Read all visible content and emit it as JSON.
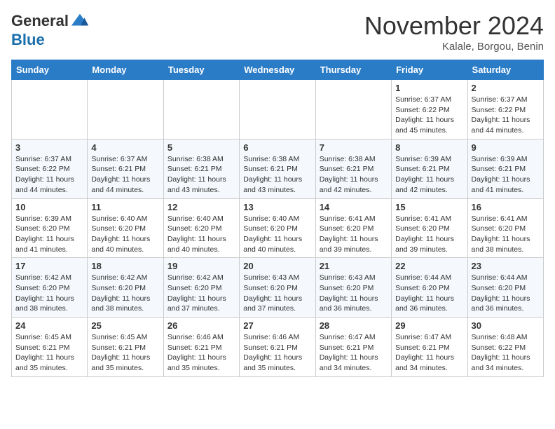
{
  "header": {
    "logo_general": "General",
    "logo_blue": "Blue",
    "month_title": "November 2024",
    "location": "Kalale, Borgou, Benin"
  },
  "days_of_week": [
    "Sunday",
    "Monday",
    "Tuesday",
    "Wednesday",
    "Thursday",
    "Friday",
    "Saturday"
  ],
  "weeks": [
    [
      {
        "day": "",
        "detail": ""
      },
      {
        "day": "",
        "detail": ""
      },
      {
        "day": "",
        "detail": ""
      },
      {
        "day": "",
        "detail": ""
      },
      {
        "day": "",
        "detail": ""
      },
      {
        "day": "1",
        "detail": "Sunrise: 6:37 AM\nSunset: 6:22 PM\nDaylight: 11 hours and 45 minutes."
      },
      {
        "day": "2",
        "detail": "Sunrise: 6:37 AM\nSunset: 6:22 PM\nDaylight: 11 hours and 44 minutes."
      }
    ],
    [
      {
        "day": "3",
        "detail": "Sunrise: 6:37 AM\nSunset: 6:22 PM\nDaylight: 11 hours and 44 minutes."
      },
      {
        "day": "4",
        "detail": "Sunrise: 6:37 AM\nSunset: 6:21 PM\nDaylight: 11 hours and 44 minutes."
      },
      {
        "day": "5",
        "detail": "Sunrise: 6:38 AM\nSunset: 6:21 PM\nDaylight: 11 hours and 43 minutes."
      },
      {
        "day": "6",
        "detail": "Sunrise: 6:38 AM\nSunset: 6:21 PM\nDaylight: 11 hours and 43 minutes."
      },
      {
        "day": "7",
        "detail": "Sunrise: 6:38 AM\nSunset: 6:21 PM\nDaylight: 11 hours and 42 minutes."
      },
      {
        "day": "8",
        "detail": "Sunrise: 6:39 AM\nSunset: 6:21 PM\nDaylight: 11 hours and 42 minutes."
      },
      {
        "day": "9",
        "detail": "Sunrise: 6:39 AM\nSunset: 6:21 PM\nDaylight: 11 hours and 41 minutes."
      }
    ],
    [
      {
        "day": "10",
        "detail": "Sunrise: 6:39 AM\nSunset: 6:20 PM\nDaylight: 11 hours and 41 minutes."
      },
      {
        "day": "11",
        "detail": "Sunrise: 6:40 AM\nSunset: 6:20 PM\nDaylight: 11 hours and 40 minutes."
      },
      {
        "day": "12",
        "detail": "Sunrise: 6:40 AM\nSunset: 6:20 PM\nDaylight: 11 hours and 40 minutes."
      },
      {
        "day": "13",
        "detail": "Sunrise: 6:40 AM\nSunset: 6:20 PM\nDaylight: 11 hours and 40 minutes."
      },
      {
        "day": "14",
        "detail": "Sunrise: 6:41 AM\nSunset: 6:20 PM\nDaylight: 11 hours and 39 minutes."
      },
      {
        "day": "15",
        "detail": "Sunrise: 6:41 AM\nSunset: 6:20 PM\nDaylight: 11 hours and 39 minutes."
      },
      {
        "day": "16",
        "detail": "Sunrise: 6:41 AM\nSunset: 6:20 PM\nDaylight: 11 hours and 38 minutes."
      }
    ],
    [
      {
        "day": "17",
        "detail": "Sunrise: 6:42 AM\nSunset: 6:20 PM\nDaylight: 11 hours and 38 minutes."
      },
      {
        "day": "18",
        "detail": "Sunrise: 6:42 AM\nSunset: 6:20 PM\nDaylight: 11 hours and 38 minutes."
      },
      {
        "day": "19",
        "detail": "Sunrise: 6:42 AM\nSunset: 6:20 PM\nDaylight: 11 hours and 37 minutes."
      },
      {
        "day": "20",
        "detail": "Sunrise: 6:43 AM\nSunset: 6:20 PM\nDaylight: 11 hours and 37 minutes."
      },
      {
        "day": "21",
        "detail": "Sunrise: 6:43 AM\nSunset: 6:20 PM\nDaylight: 11 hours and 36 minutes."
      },
      {
        "day": "22",
        "detail": "Sunrise: 6:44 AM\nSunset: 6:20 PM\nDaylight: 11 hours and 36 minutes."
      },
      {
        "day": "23",
        "detail": "Sunrise: 6:44 AM\nSunset: 6:20 PM\nDaylight: 11 hours and 36 minutes."
      }
    ],
    [
      {
        "day": "24",
        "detail": "Sunrise: 6:45 AM\nSunset: 6:21 PM\nDaylight: 11 hours and 35 minutes."
      },
      {
        "day": "25",
        "detail": "Sunrise: 6:45 AM\nSunset: 6:21 PM\nDaylight: 11 hours and 35 minutes."
      },
      {
        "day": "26",
        "detail": "Sunrise: 6:46 AM\nSunset: 6:21 PM\nDaylight: 11 hours and 35 minutes."
      },
      {
        "day": "27",
        "detail": "Sunrise: 6:46 AM\nSunset: 6:21 PM\nDaylight: 11 hours and 35 minutes."
      },
      {
        "day": "28",
        "detail": "Sunrise: 6:47 AM\nSunset: 6:21 PM\nDaylight: 11 hours and 34 minutes."
      },
      {
        "day": "29",
        "detail": "Sunrise: 6:47 AM\nSunset: 6:21 PM\nDaylight: 11 hours and 34 minutes."
      },
      {
        "day": "30",
        "detail": "Sunrise: 6:48 AM\nSunset: 6:22 PM\nDaylight: 11 hours and 34 minutes."
      }
    ]
  ]
}
